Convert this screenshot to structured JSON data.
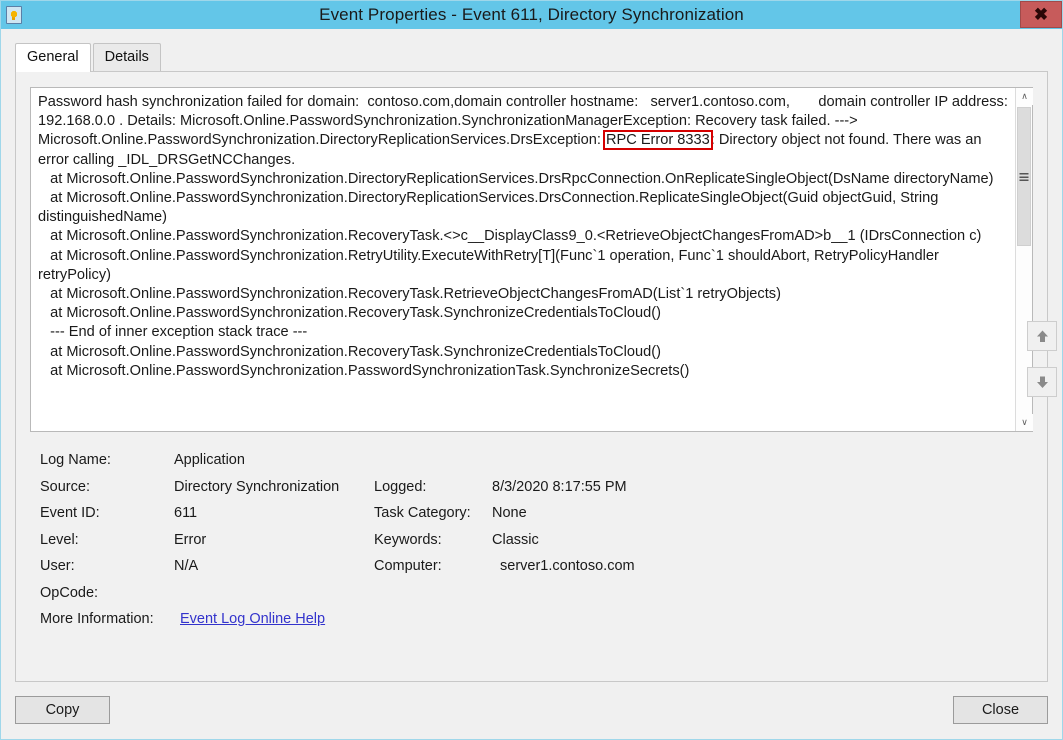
{
  "window": {
    "title": "Event Properties - Event 611, Directory Synchronization",
    "icon": "event-log-icon",
    "close_glyph": "✖"
  },
  "tabs": [
    {
      "label": "General",
      "active": true
    },
    {
      "label": "Details",
      "active": false
    }
  ],
  "description": {
    "segments": [
      {
        "text": "Password hash synchronization failed for domain:  contoso.com,domain controller hostname:   server1.contoso.com,       domain controller IP address: 192.168.0.0 . Details: Microsoft.Online.PasswordSynchronization.SynchronizationManagerException: Recovery task failed. ---> Microsoft.Online.PasswordSynchronization.DirectoryReplicationServices.DrsException: "
      },
      {
        "text": "RPC Error 8333",
        "highlight": true
      },
      {
        "text": ": Directory object not found. There was an error calling _IDL_DRSGetNCChanges.\n   at Microsoft.Online.PasswordSynchronization.DirectoryReplicationServices.DrsRpcConnection.OnReplicateSingleObject(DsName directoryName)\n   at Microsoft.Online.PasswordSynchronization.DirectoryReplicationServices.DrsConnection.ReplicateSingleObject(Guid objectGuid, String distinguishedName)\n   at Microsoft.Online.PasswordSynchronization.RecoveryTask.<>c__DisplayClass9_0.<RetrieveObjectChangesFromAD>b__1 (IDrsConnection c)\n   at Microsoft.Online.PasswordSynchronization.RetryUtility.ExecuteWithRetry[T](Func`1 operation, Func`1 shouldAbort, RetryPolicyHandler retryPolicy)\n   at Microsoft.Online.PasswordSynchronization.RecoveryTask.RetrieveObjectChangesFromAD(List`1 retryObjects)\n   at Microsoft.Online.PasswordSynchronization.RecoveryTask.SynchronizeCredentialsToCloud()\n   --- End of inner exception stack trace ---\n   at Microsoft.Online.PasswordSynchronization.RecoveryTask.SynchronizeCredentialsToCloud()\n   at Microsoft.Online.PasswordSynchronization.PasswordSynchronizationTask.SynchronizeSecrets()"
      }
    ],
    "highlight_color": "#d50000"
  },
  "fields": {
    "log_name_label": "Log Name:",
    "log_name_value": "Application",
    "source_label": "Source:",
    "source_value": "Directory Synchronization",
    "event_id_label": "Event ID:",
    "event_id_value": "611",
    "level_label": "Level:",
    "level_value": "Error",
    "user_label": "User:",
    "user_value": "N/A",
    "opcode_label": "OpCode:",
    "opcode_value": "",
    "more_info_label": "More Information:",
    "more_info_link": "Event Log Online Help",
    "logged_label": "Logged:",
    "logged_value": "8/3/2020 8:17:55 PM",
    "task_category_label": "Task Category:",
    "task_category_value": "None",
    "keywords_label": "Keywords:",
    "keywords_value": "Classic",
    "computer_label": "Computer:",
    "computer_value": "server1.contoso.com"
  },
  "side_buttons": {
    "previous_event": "up-arrow-icon",
    "next_event": "down-arrow-icon"
  },
  "footer": {
    "copy_label": "Copy",
    "close_label": "Close"
  },
  "scrollbar": {
    "up_glyph": "∧",
    "down_glyph": "∨"
  },
  "colors": {
    "titlebar": "#63c6e8",
    "close_button": "#c75b5b",
    "highlight": "#d50000",
    "link": "#3333cc",
    "panel_bg": "#f1f1f1"
  }
}
